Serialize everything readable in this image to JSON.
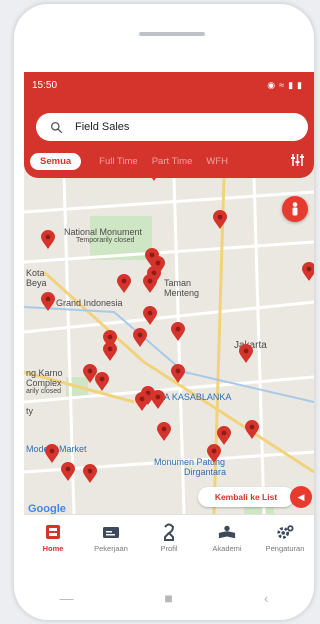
{
  "status_bar": {
    "time": "15:50",
    "icons": [
      "location-icon",
      "wifi-icon",
      "signal-icon",
      "battery-icon"
    ]
  },
  "search": {
    "value": "Field Sales"
  },
  "filters": {
    "tabs": [
      "Semua",
      "Full Time",
      "Part Time",
      "WFH"
    ],
    "selected": "Semua"
  },
  "map": {
    "labels": {
      "national_monument": "National Monument",
      "temporarily_closed": "Temporarily closed",
      "kota": "Kota",
      "beya": "Beya",
      "taman": "Taman",
      "menteng": "Menteng",
      "grand_indonesia": "Grand Indonesia",
      "jakarta": "Jakarta",
      "ng_karno": "ng Karno",
      "complex": "Complex",
      "arily_closed": "arily closed",
      "ty": "ty",
      "kota_kasablanka": "KOTA KASABLANKA",
      "modern_market": "Modern Market",
      "menara_patung": "Monumen Patung",
      "dirgantara": "Dirgantara"
    },
    "google_logo": "Google",
    "accent_pin_color": "#d4342b"
  },
  "actions": {
    "kembali_label": "Kembali ke List"
  },
  "bottom_nav": [
    {
      "label": "Home",
      "icon": "home-icon",
      "active": true
    },
    {
      "label": "Pekerjaan",
      "icon": "briefcase-icon",
      "active": false
    },
    {
      "label": "Profil",
      "icon": "profile-icon",
      "active": false
    },
    {
      "label": "Akademi",
      "icon": "academy-icon",
      "active": false
    },
    {
      "label": "Pengaturan",
      "icon": "settings-icon",
      "active": false
    }
  ],
  "colors": {
    "primary": "#d4342b",
    "pin": "#d4342b"
  }
}
